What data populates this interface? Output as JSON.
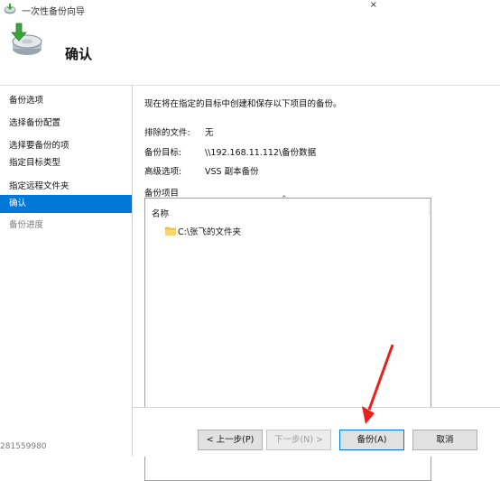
{
  "window": {
    "title": "一次性备份向导",
    "close_glyph": "×"
  },
  "header": {
    "heading": "确认"
  },
  "nav": {
    "items": [
      {
        "label": "备份选项"
      },
      {
        "label": "选择备份配置"
      },
      {
        "label": "选择要备份的项"
      },
      {
        "label": "指定目标类型"
      },
      {
        "label": "指定远程文件夹"
      },
      {
        "label": "确认"
      },
      {
        "label": "备份进度"
      }
    ],
    "active_index": 5
  },
  "content": {
    "intro": "现在将在指定的目标中创建和保存以下项目的备份。",
    "excluded_label": "排除的文件:",
    "excluded_value": "无",
    "target_label": "备份目标:",
    "target_value": "\\\\192.168.11.112\\备份数据",
    "advanced_label": "高级选项:",
    "advanced_value": "VSS 副本备份",
    "items_label": "备份项目",
    "column_name": "名称",
    "sort_glyph": "⌃",
    "items": [
      {
        "path": "C:\\张飞的文件夹"
      }
    ]
  },
  "buttons": {
    "prev": "< 上一步(P)",
    "next": "下一步(N) >",
    "backup": "备份(A)",
    "cancel": "取消"
  },
  "watermark": "281559980",
  "colors": {
    "accent": "#0078d7",
    "annotation_arrow": "#e8211b"
  }
}
